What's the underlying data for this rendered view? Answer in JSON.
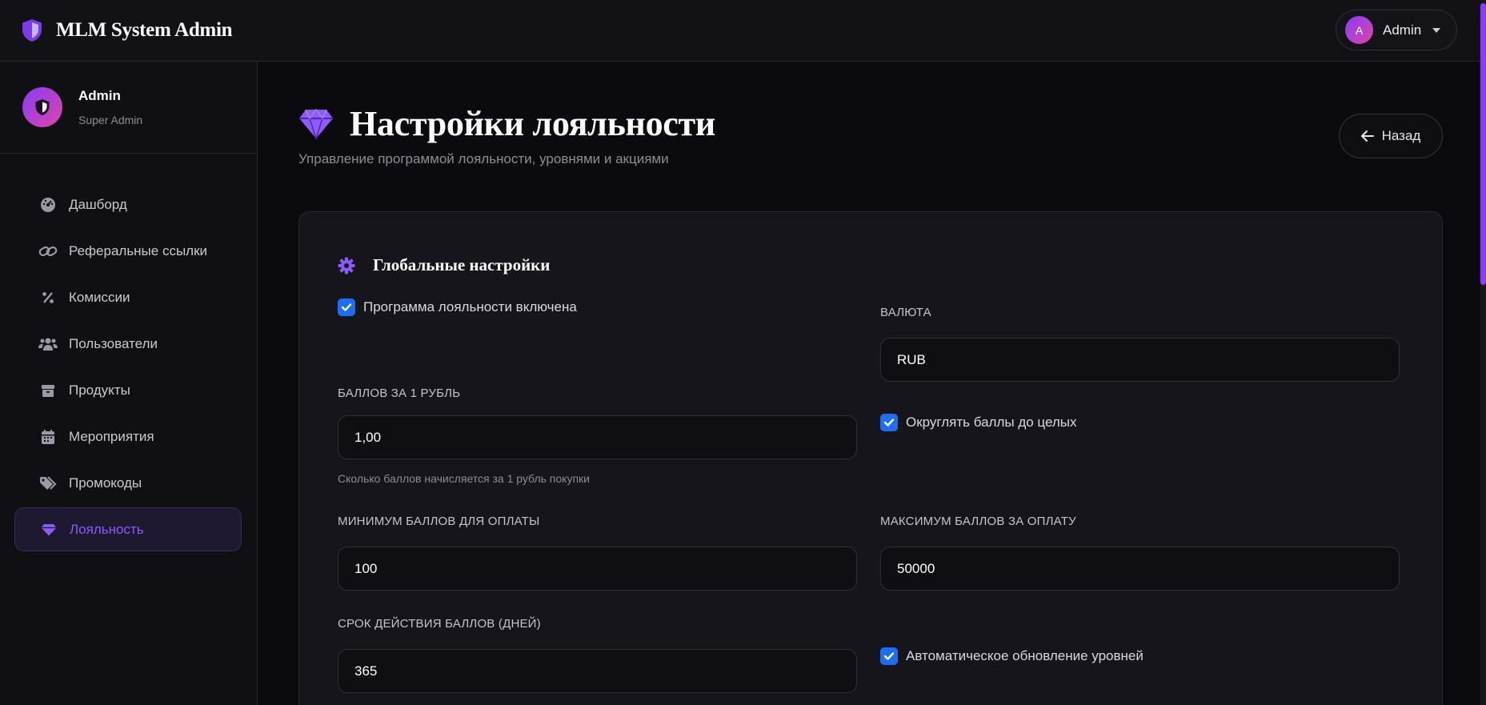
{
  "app": {
    "title": "MLM System Admin"
  },
  "user_menu": {
    "avatar_letter": "A",
    "name": "Admin"
  },
  "profile": {
    "name": "Admin",
    "role": "Super Admin"
  },
  "sidebar": {
    "items": [
      {
        "label": "Дашборд",
        "icon": "dashboard-icon"
      },
      {
        "label": "Реферальные ссылки",
        "icon": "link-icon"
      },
      {
        "label": "Комиссии",
        "icon": "percent-icon"
      },
      {
        "label": "Пользователи",
        "icon": "users-icon"
      },
      {
        "label": "Продукты",
        "icon": "box-icon"
      },
      {
        "label": "Мероприятия",
        "icon": "calendar-icon"
      },
      {
        "label": "Промокоды",
        "icon": "tags-icon"
      },
      {
        "label": "Лояльность",
        "icon": "gem-icon",
        "active": true
      }
    ]
  },
  "page": {
    "title": "Настройки лояльности",
    "subtitle": "Управление программой лояльности, уровнями и акциями",
    "back_label": "Назад"
  },
  "global_settings": {
    "title": "Глобальные настройки",
    "loyalty_enabled": {
      "label": "Программа лояльности включена",
      "checked": true
    },
    "currency": {
      "label": "ВАЛЮТА",
      "value": "RUB"
    },
    "points_per_ruble": {
      "label": "БАЛЛОВ ЗА 1 РУБЛЬ",
      "value": "1,00",
      "hint": "Сколько баллов начисляется за 1 рубль покупки"
    },
    "round_points": {
      "label": "Округлять баллы до целых",
      "checked": true
    },
    "min_points": {
      "label": "МИНИМУМ БАЛЛОВ ДЛЯ ОПЛАТЫ",
      "value": "100"
    },
    "max_points": {
      "label": "МАКСИМУМ БАЛЛОВ ЗА ОПЛАТУ",
      "value": "50000"
    },
    "expiry_days": {
      "label": "СРОК ДЕЙСТВИЯ БАЛЛОВ (ДНЕЙ)",
      "value": "365"
    },
    "auto_levels": {
      "label": "Автоматическое обновление уровней",
      "checked": true
    }
  },
  "colors": {
    "accent": "#8b5cf6",
    "checkbox": "#1d6ef2",
    "background": "#0b0b0f"
  }
}
